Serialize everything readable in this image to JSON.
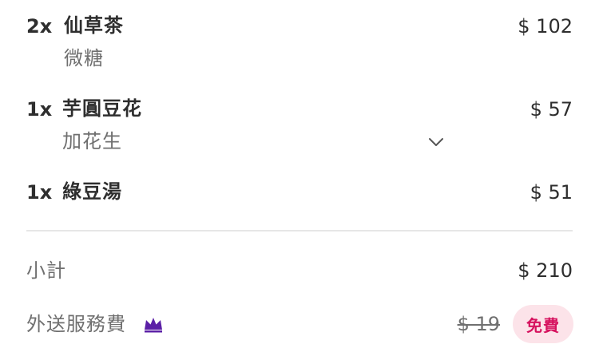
{
  "order_items": [
    {
      "quantity": "2x",
      "name": "仙草茶",
      "option": "微糖",
      "price": "$ 102"
    },
    {
      "quantity": "1x",
      "name": "芋圓豆花",
      "option": "加花生",
      "price": "$ 57"
    },
    {
      "quantity": "1x",
      "name": "綠豆湯",
      "option": "",
      "price": "$ 51"
    }
  ],
  "summary": {
    "subtotal_label": "小計",
    "subtotal_value": "$ 210",
    "delivery_label": "外送服務費",
    "delivery_original": "$ 19",
    "delivery_badge": "免費"
  },
  "icons": {
    "expand": "chevron-down-icon",
    "membership": "crown-icon"
  },
  "colors": {
    "crown": "#5b1fa6",
    "badge_bg": "#fce3e9",
    "badge_text": "#d6135f"
  }
}
